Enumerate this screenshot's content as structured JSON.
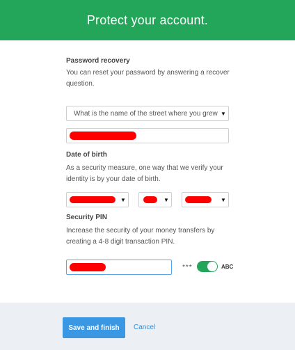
{
  "header": {
    "title": "Protect your account."
  },
  "password_recovery": {
    "title": "Password recovery",
    "description": "You can reset your password by answering a recover question.",
    "question_select": "What is the name of the street where you grew"
  },
  "dob": {
    "title": "Date of birth",
    "description": "As a security measure, one way that we verify your identity is by your date of birth."
  },
  "security_pin": {
    "title": "Security PIN",
    "description": "Increase the security of your money transfers by creating a 4-8 digit transaction PIN.",
    "mask_label": "***",
    "reveal_label": "ABC"
  },
  "footer": {
    "save_label": "Save and finish",
    "cancel_label": "Cancel"
  },
  "colors": {
    "header_green": "#24a65a",
    "primary_button": "#3a97e3",
    "link_blue": "#2f8fdf",
    "redaction_red": "#ff0000"
  }
}
